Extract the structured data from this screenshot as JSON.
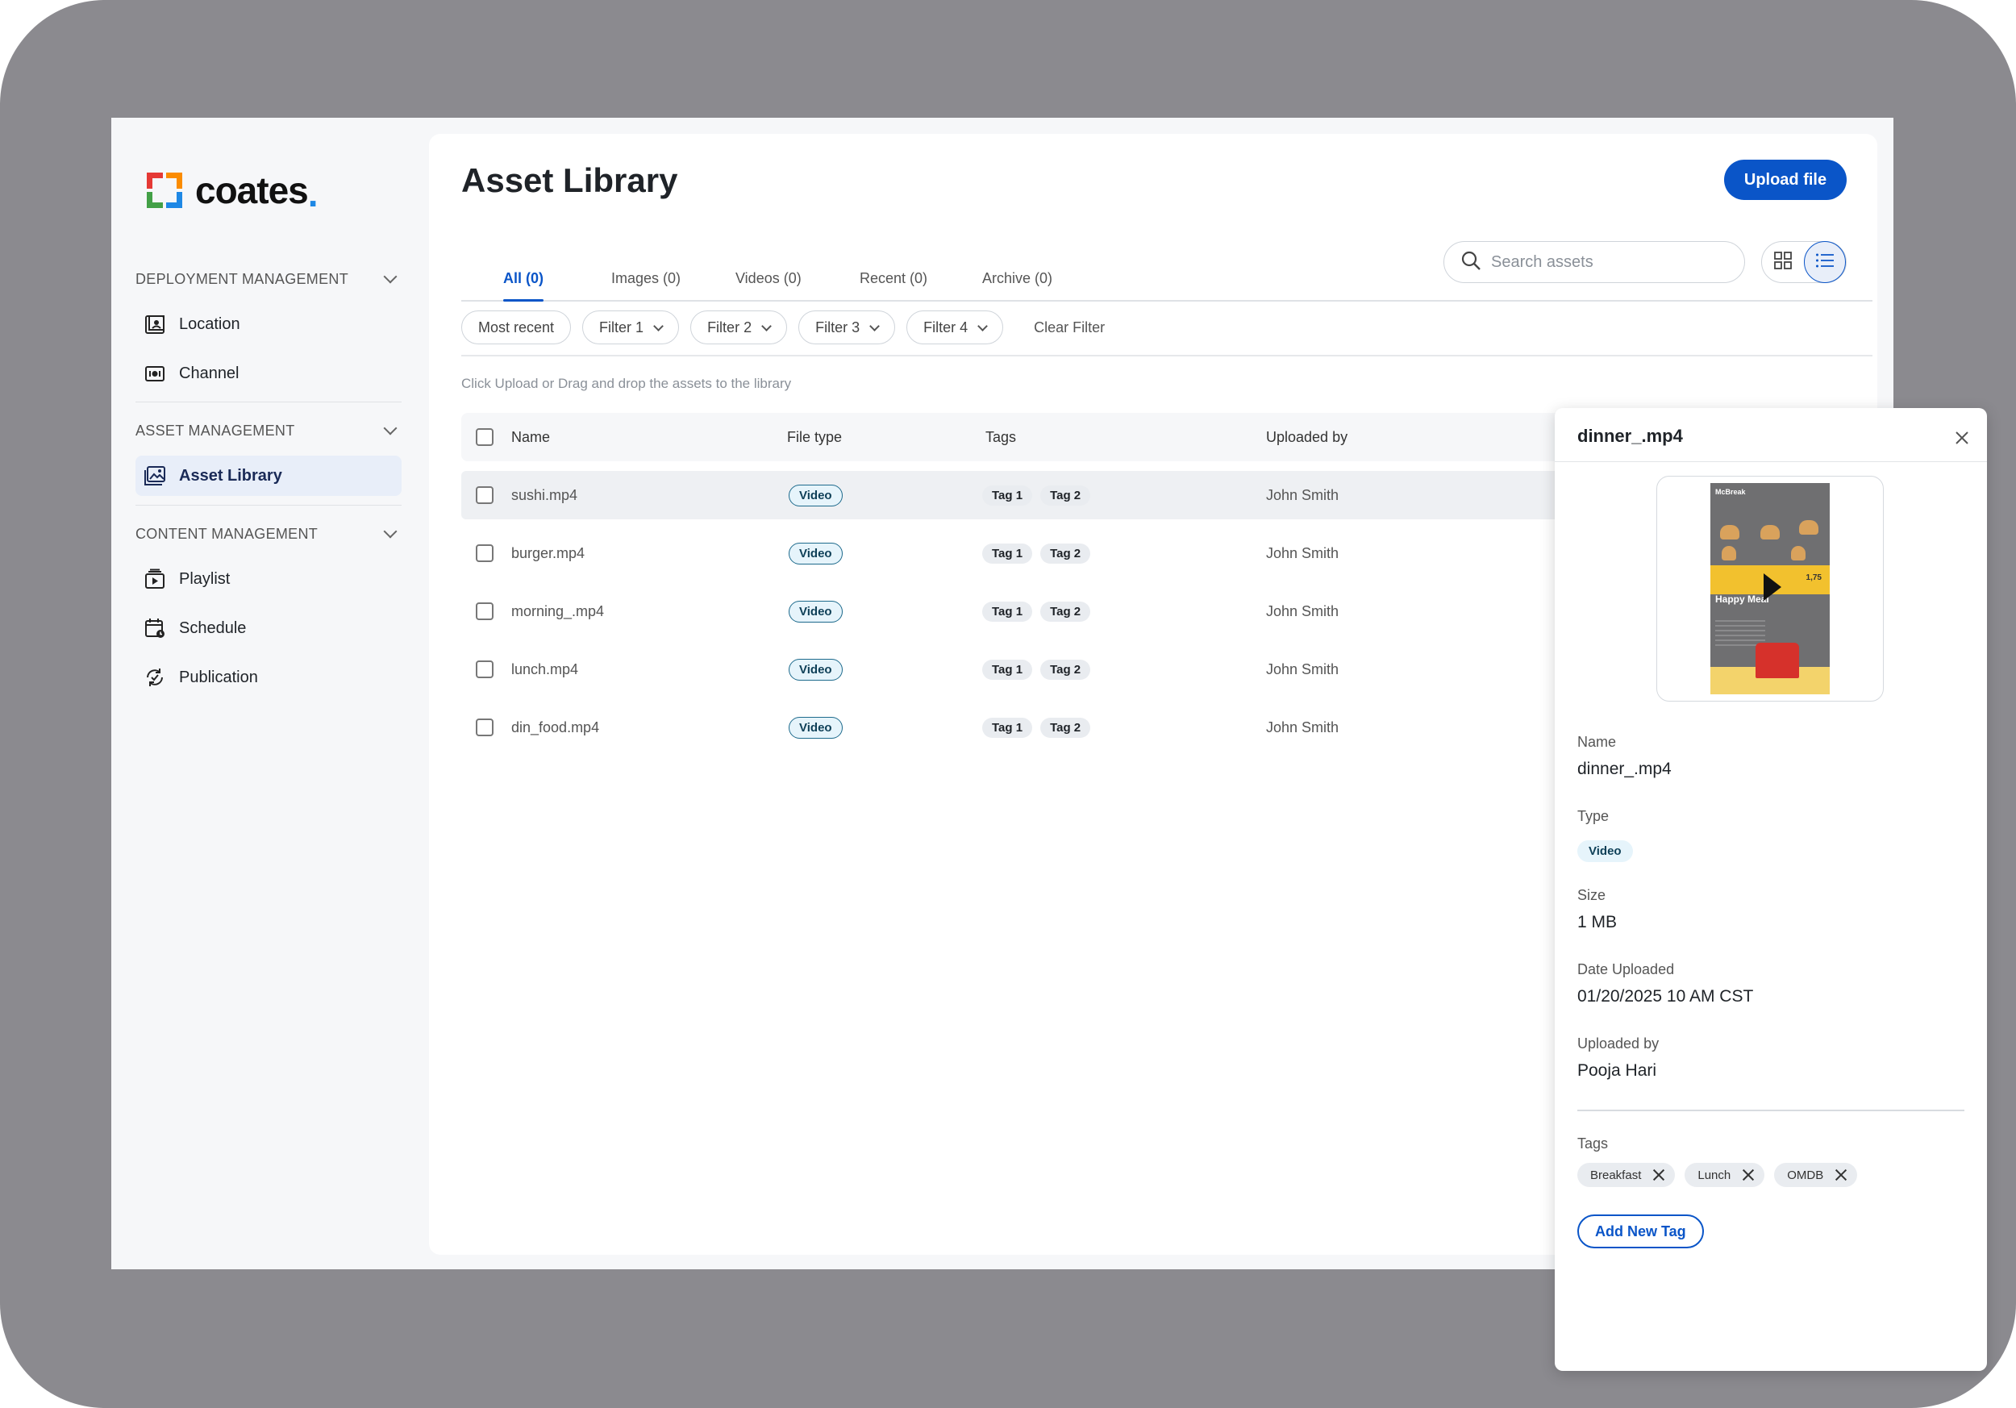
{
  "brand": {
    "name": "coates",
    "dot": "."
  },
  "sidebar": {
    "sections": [
      {
        "label": "DEPLOYMENT MANAGEMENT",
        "items": [
          {
            "label": "Location",
            "icon": "location-icon"
          },
          {
            "label": "Channel",
            "icon": "channel-icon"
          }
        ]
      },
      {
        "label": "ASSET MANAGEMENT",
        "items": [
          {
            "label": "Asset Library",
            "icon": "image-library-icon",
            "active": true
          }
        ]
      },
      {
        "label": "CONTENT MANAGEMENT",
        "items": [
          {
            "label": "Playlist",
            "icon": "playlist-icon"
          },
          {
            "label": "Schedule",
            "icon": "calendar-icon"
          },
          {
            "label": "Publication",
            "icon": "publication-icon"
          }
        ]
      }
    ]
  },
  "header": {
    "title": "Asset Library",
    "upload_label": "Upload file"
  },
  "tabs": [
    {
      "label": "All (0)",
      "active": true
    },
    {
      "label": "Images (0)"
    },
    {
      "label": "Videos (0)"
    },
    {
      "label": "Recent (0)"
    },
    {
      "label": "Archive (0)"
    }
  ],
  "search": {
    "placeholder": "Search assets"
  },
  "filters": {
    "sort": "Most recent",
    "dropdowns": [
      "Filter 1",
      "Filter 2",
      "Filter 3",
      "Filter 4"
    ],
    "clear": "Clear Filter"
  },
  "hint": "Click Upload or Drag and drop the assets to the library",
  "table": {
    "columns": [
      "Name",
      "File type",
      "Tags",
      "Uploaded by"
    ],
    "rows": [
      {
        "name": "sushi.mp4",
        "type": "Video",
        "tags": [
          "Tag 1",
          "Tag 2"
        ],
        "uploaded_by": "John Smith"
      },
      {
        "name": "burger.mp4",
        "type": "Video",
        "tags": [
          "Tag 1",
          "Tag 2"
        ],
        "uploaded_by": "John Smith"
      },
      {
        "name": "morning_.mp4",
        "type": "Video",
        "tags": [
          "Tag 1",
          "Tag 2"
        ],
        "uploaded_by": "John Smith"
      },
      {
        "name": "lunch.mp4",
        "type": "Video",
        "tags": [
          "Tag 1",
          "Tag 2"
        ],
        "uploaded_by": "John Smith"
      },
      {
        "name": "din_food.mp4",
        "type": "Video",
        "tags": [
          "Tag 1",
          "Tag 2"
        ],
        "uploaded_by": "John Smith"
      }
    ]
  },
  "details": {
    "title": "dinner_.mp4",
    "preview": {
      "brand_text": "McBreak",
      "headline": "Happy Meal",
      "price": "1,75"
    },
    "fields": {
      "name_label": "Name",
      "name": "dinner_.mp4",
      "type_label": "Type",
      "type": "Video",
      "size_label": "Size",
      "size": "1 MB",
      "date_label": "Date Uploaded",
      "date": "01/20/2025 10 AM CST",
      "uploader_label": "Uploaded by",
      "uploader": "Pooja Hari"
    },
    "tags_label": "Tags",
    "tags": [
      "Breakfast",
      "Lunch",
      "OMDB"
    ],
    "add_tag_label": "Add New Tag"
  },
  "colors": {
    "accent": "#0a55c8",
    "frame": "#8b8a8f",
    "video_badge": "#e6f4fb"
  }
}
